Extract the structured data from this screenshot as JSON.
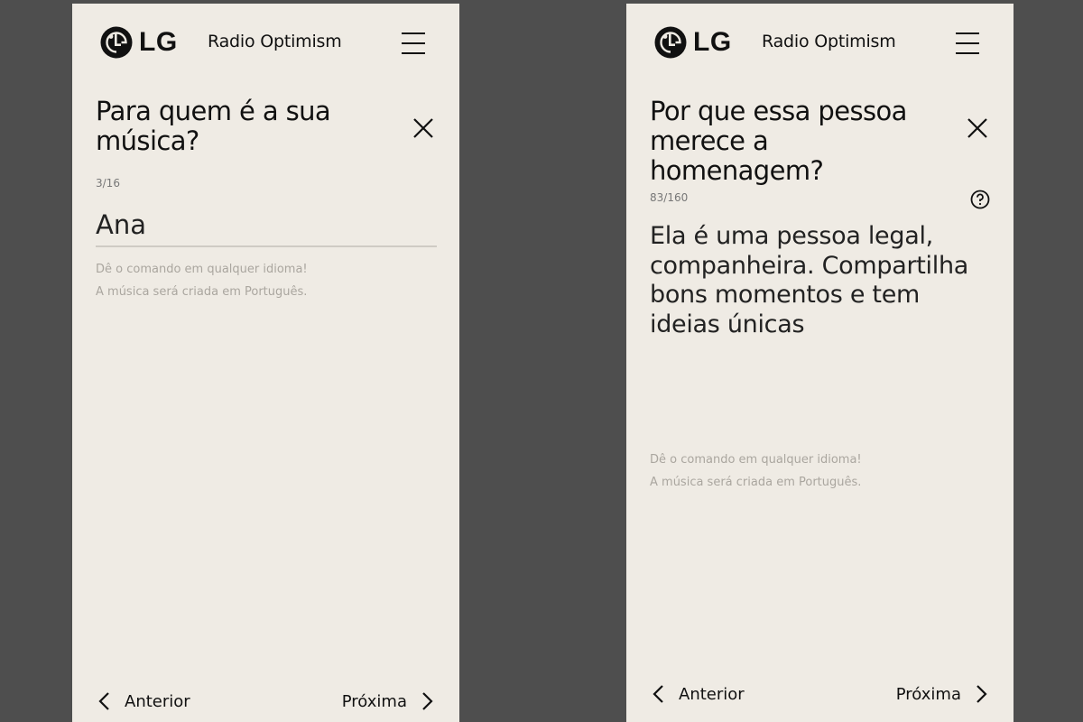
{
  "app": {
    "logo_text": "LG",
    "title": "Radio Optimism"
  },
  "screens": [
    {
      "question": "Para quem é a sua música?",
      "counter": "3/16",
      "input_value": "Ana",
      "hint_line1": "Dê o comando em qualquer idioma!",
      "hint_line2": "A música será criada em Português.",
      "prev_label": "Anterior",
      "next_label": "Próxima"
    },
    {
      "question": "Por que essa pessoa merece a homenagem?",
      "counter": "83/160",
      "answer": "Ela é uma pessoa legal, companheira. Compartilha bons momentos e tem ideias únicas",
      "hint_line1": "Dê o comando em qualquer idioma!",
      "hint_line2": "A música será criada em Português.",
      "prev_label": "Anterior",
      "next_label": "Próxima"
    }
  ],
  "icons": {
    "logo": "lg-face-logo-icon",
    "menu": "hamburger-menu-icon",
    "close": "close-icon",
    "help": "question-circle-icon",
    "prev": "chevron-left-icon",
    "next": "chevron-right-icon"
  }
}
